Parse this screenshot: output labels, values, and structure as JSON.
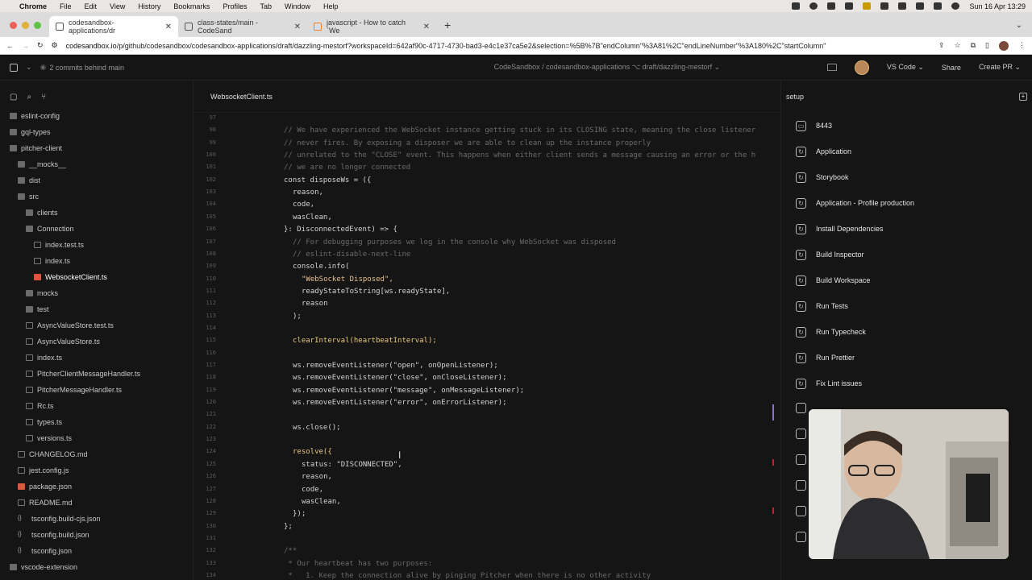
{
  "menubar": {
    "items": [
      "Chrome",
      "File",
      "Edit",
      "View",
      "History",
      "Bookmarks",
      "Profiles",
      "Tab",
      "Window",
      "Help"
    ],
    "clock": "Sun 16 Apr 13:29"
  },
  "browser": {
    "tabs": [
      {
        "title": "codesandbox-applications/dr",
        "active": true
      },
      {
        "title": "class-states/main - CodeSand",
        "active": false
      },
      {
        "title": "javascript - How to catch `We",
        "active": false
      }
    ],
    "url_domain": "codesandbox.io",
    "url_path": "/p/github/codesandbox/codesandbox-applications/draft/dazzling-mestorf?workspaceId=642af90c-4717-4730-bad3-e4c1e37ca5e2&selection=%5B%7B\"endColumn\"%3A81%2C\"endLineNumber\"%3A180%2C\"startColumn\""
  },
  "app_header": {
    "commits_behind": "2 commits behind main",
    "breadcrumb": "CodeSandbox / codesandbox-applications ⌥ draft/dazzling-mestorf ⌄",
    "editor_label": "VS Code ⌄",
    "share_label": "Share",
    "create_pr_label": "Create PR ⌄"
  },
  "file_tree": [
    {
      "label": "eslint-config",
      "indent": 1,
      "type": "folder"
    },
    {
      "label": "gql-types",
      "indent": 1,
      "type": "folder"
    },
    {
      "label": "pitcher-client",
      "indent": 1,
      "type": "folder-open"
    },
    {
      "label": "__mocks__",
      "indent": 2,
      "type": "folder"
    },
    {
      "label": "dist",
      "indent": 2,
      "type": "folder"
    },
    {
      "label": "src",
      "indent": 2,
      "type": "folder-open"
    },
    {
      "label": "clients",
      "indent": 3,
      "type": "folder"
    },
    {
      "label": "Connection",
      "indent": 3,
      "type": "folder-open"
    },
    {
      "label": "index.test.ts",
      "indent": 4,
      "type": "file"
    },
    {
      "label": "index.ts",
      "indent": 4,
      "type": "file"
    },
    {
      "label": "WebsocketClient.ts",
      "indent": 4,
      "type": "file-ts",
      "selected": true
    },
    {
      "label": "mocks",
      "indent": 3,
      "type": "folder"
    },
    {
      "label": "test",
      "indent": 3,
      "type": "folder"
    },
    {
      "label": "AsyncValueStore.test.ts",
      "indent": 3,
      "type": "file"
    },
    {
      "label": "AsyncValueStore.ts",
      "indent": 3,
      "type": "file"
    },
    {
      "label": "index.ts",
      "indent": 3,
      "type": "file"
    },
    {
      "label": "PitcherClientMessageHandler.ts",
      "indent": 3,
      "type": "file"
    },
    {
      "label": "PitcherMessageHandler.ts",
      "indent": 3,
      "type": "file"
    },
    {
      "label": "Rc.ts",
      "indent": 3,
      "type": "file-ts"
    },
    {
      "label": "types.ts",
      "indent": 3,
      "type": "file"
    },
    {
      "label": "versions.ts",
      "indent": 3,
      "type": "file"
    },
    {
      "label": "CHANGELOG.md",
      "indent": 2,
      "type": "file-md"
    },
    {
      "label": "jest.config.js",
      "indent": 2,
      "type": "file"
    },
    {
      "label": "package.json",
      "indent": 2,
      "type": "file-pkg"
    },
    {
      "label": "README.md",
      "indent": 2,
      "type": "file-md"
    },
    {
      "label": "tsconfig.build-cjs.json",
      "indent": 2,
      "type": "file-json"
    },
    {
      "label": "tsconfig.build.json",
      "indent": 2,
      "type": "file-json"
    },
    {
      "label": "tsconfig.json",
      "indent": 2,
      "type": "file-json"
    },
    {
      "label": "vscode-extension",
      "indent": 1,
      "type": "folder"
    }
  ],
  "editor": {
    "active_file": "WebsocketClient.ts",
    "lines": [
      {
        "n": "97",
        "text": "",
        "indent": 0
      },
      {
        "n": "98",
        "text": "// We have experienced the WebSocket instance getting stuck in its CLOSING state, meaning the close listener",
        "indent": 0,
        "kind": "cm"
      },
      {
        "n": "99",
        "text": "// never fires. By exposing a disposer we are able to clean up the instance properly",
        "indent": 0,
        "kind": "cm"
      },
      {
        "n": "100",
        "text": "// unrelated to the \"CLOSE\" event. This happens when either client sends a message causing an error or the h",
        "indent": 0,
        "kind": "cm"
      },
      {
        "n": "101",
        "text": "// we are no longer connected",
        "indent": 0,
        "kind": "cm"
      },
      {
        "n": "102",
        "text": "const disposeWs = ({",
        "indent": 0,
        "kind": "code"
      },
      {
        "n": "103",
        "text": "reason,",
        "indent": 1,
        "kind": "code"
      },
      {
        "n": "104",
        "text": "code,",
        "indent": 1,
        "kind": "code"
      },
      {
        "n": "105",
        "text": "wasClean,",
        "indent": 1,
        "kind": "code"
      },
      {
        "n": "106",
        "text": "}: DisconnectedEvent) => {",
        "indent": 0,
        "kind": "code"
      },
      {
        "n": "107",
        "text": "// For debugging purposes we log in the console why WebSocket was disposed",
        "indent": 1,
        "kind": "cm"
      },
      {
        "n": "108",
        "text": "// eslint-disable-next-line",
        "indent": 1,
        "kind": "cm"
      },
      {
        "n": "109",
        "text": "console.info(",
        "indent": 1,
        "kind": "code"
      },
      {
        "n": "110",
        "text": "\"WebSocket Disposed\",",
        "indent": 2,
        "kind": "str"
      },
      {
        "n": "111",
        "text": "readyStateToString[ws.readyState],",
        "indent": 2,
        "kind": "code"
      },
      {
        "n": "112",
        "text": "reason",
        "indent": 2,
        "kind": "code"
      },
      {
        "n": "113",
        "text": ");",
        "indent": 1,
        "kind": "code"
      },
      {
        "n": "114",
        "text": "",
        "indent": 0
      },
      {
        "n": "115",
        "text": "clearInterval(heartbeatInterval);",
        "indent": 1,
        "kind": "fncall"
      },
      {
        "n": "116",
        "text": "",
        "indent": 0
      },
      {
        "n": "117",
        "text": "ws.removeEventListener(\"open\", onOpenListener);",
        "indent": 1,
        "kind": "code"
      },
      {
        "n": "118",
        "text": "ws.removeEventListener(\"close\", onCloseListener);",
        "indent": 1,
        "kind": "code"
      },
      {
        "n": "119",
        "text": "ws.removeEventListener(\"message\", onMessageListener);",
        "indent": 1,
        "kind": "code"
      },
      {
        "n": "120",
        "text": "ws.removeEventListener(\"error\", onErrorListener);",
        "indent": 1,
        "kind": "code"
      },
      {
        "n": "121",
        "text": "",
        "indent": 0
      },
      {
        "n": "122",
        "text": "ws.close();",
        "indent": 1,
        "kind": "code"
      },
      {
        "n": "123",
        "text": "",
        "indent": 0
      },
      {
        "n": "124",
        "text": "resolve({",
        "indent": 1,
        "kind": "fncall"
      },
      {
        "n": "125",
        "text": "status: \"DISCONNECTED\",",
        "indent": 2,
        "kind": "code"
      },
      {
        "n": "126",
        "text": "reason,",
        "indent": 2,
        "kind": "code"
      },
      {
        "n": "127",
        "text": "code,",
        "indent": 2,
        "kind": "code"
      },
      {
        "n": "128",
        "text": "wasClean,",
        "indent": 2,
        "kind": "code"
      },
      {
        "n": "129",
        "text": "});",
        "indent": 1,
        "kind": "code"
      },
      {
        "n": "130",
        "text": "};",
        "indent": 0,
        "kind": "code"
      },
      {
        "n": "131",
        "text": "",
        "indent": 0
      },
      {
        "n": "132",
        "text": "/**",
        "indent": 0,
        "kind": "cm"
      },
      {
        "n": "133",
        "text": " * Our heartbeat has two purposes:",
        "indent": 0,
        "kind": "cm"
      },
      {
        "n": "134",
        "text": " *   1. Keep the connection alive by pinging Pitcher when there is no other activity",
        "indent": 0,
        "kind": "cm"
      }
    ]
  },
  "setup_panel": {
    "title": "setup",
    "tasks": [
      {
        "label": "8443",
        "icon": "preview-icon"
      },
      {
        "label": "Application",
        "icon": "refresh-icon"
      },
      {
        "label": "Storybook",
        "icon": "refresh-icon"
      },
      {
        "label": "Application - Profile production",
        "icon": "refresh-icon"
      },
      {
        "label": "Install Dependencies",
        "icon": "refresh-icon"
      },
      {
        "label": "Build Inspector",
        "icon": "refresh-icon"
      },
      {
        "label": "Build Workspace",
        "icon": "refresh-icon"
      },
      {
        "label": "Run Tests",
        "icon": "refresh-icon"
      },
      {
        "label": "Run Typecheck",
        "icon": "refresh-icon"
      },
      {
        "label": "Run Prettier",
        "icon": "refresh-icon"
      },
      {
        "label": "Fix Lint issues",
        "icon": "refresh-icon"
      }
    ]
  },
  "colors": {
    "bg": "#151515",
    "accent_red": "#e2523f",
    "folder": "#6b6b6b"
  }
}
